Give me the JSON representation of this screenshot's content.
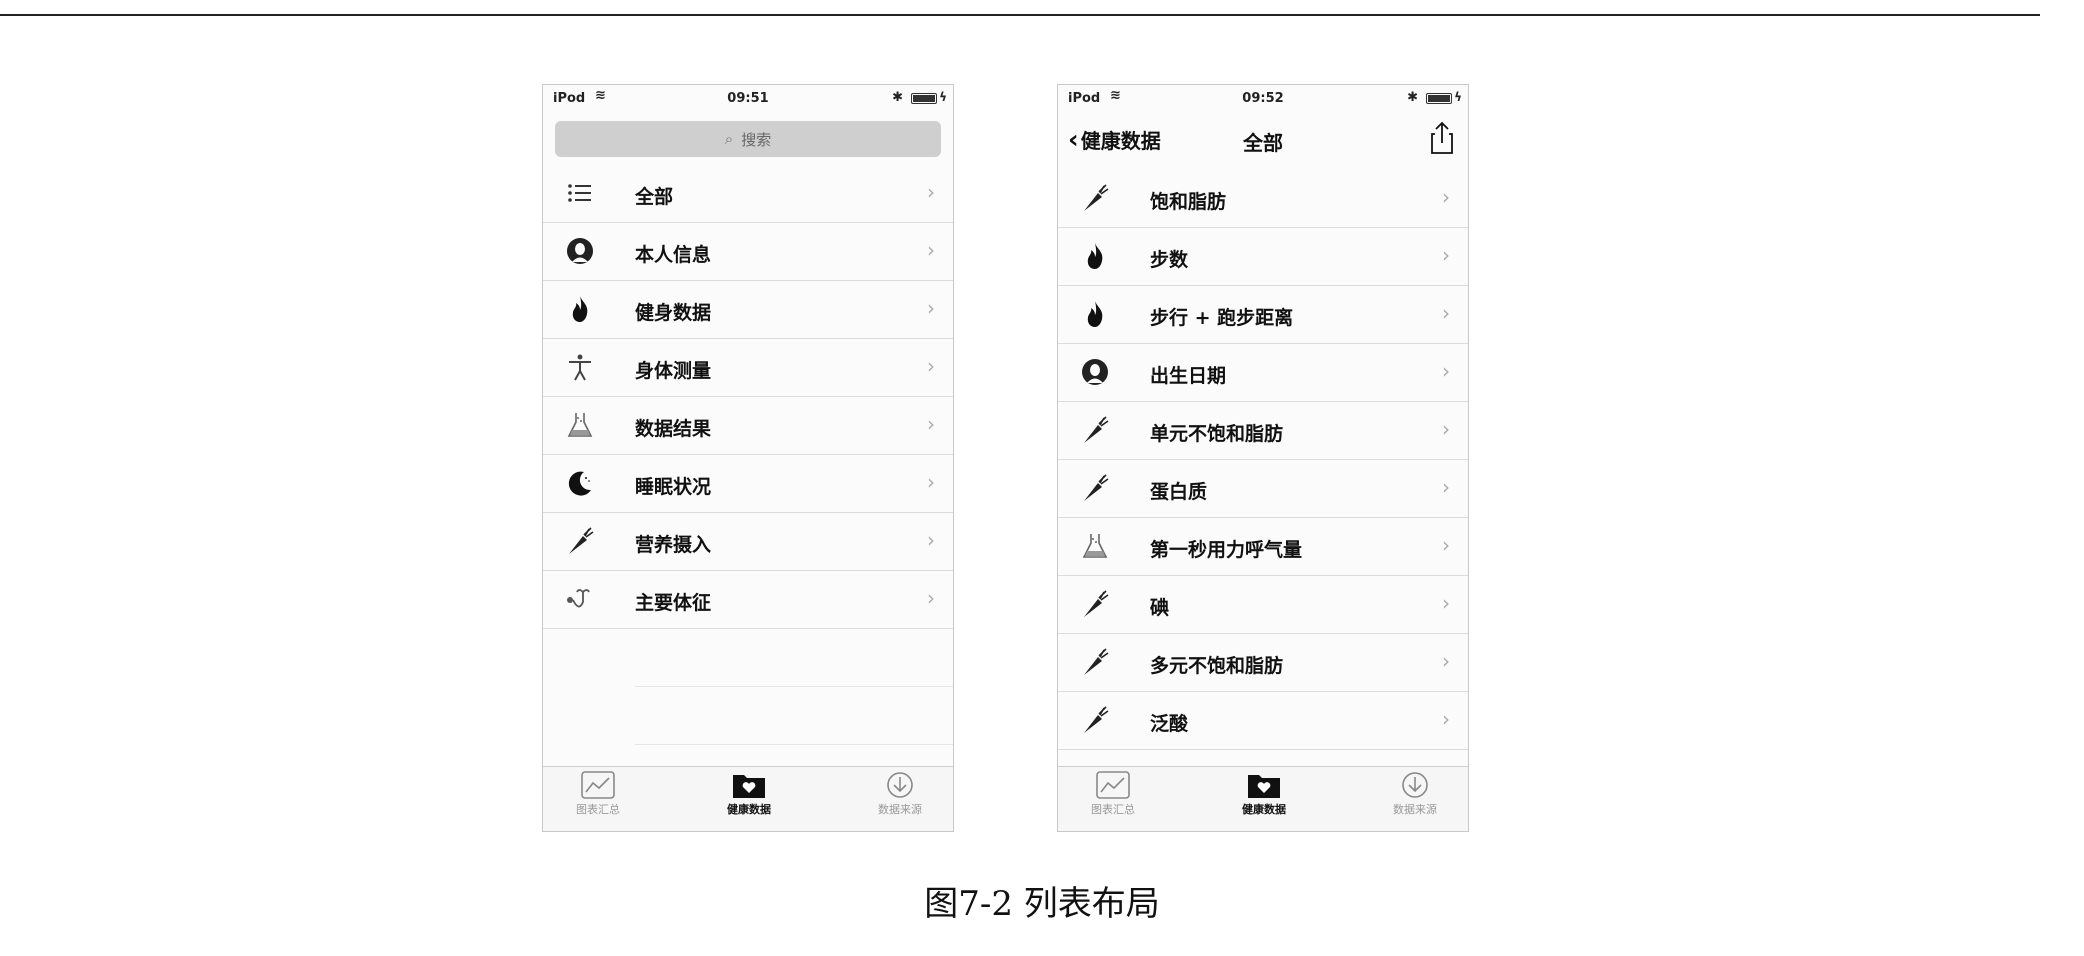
{
  "caption": "图7-2   列表布局",
  "left_screen": {
    "status": {
      "carrier": "iPod",
      "time": "09:51"
    },
    "search_placeholder": "搜索",
    "items": [
      {
        "label": "全部",
        "icon": "list-icon"
      },
      {
        "label": "本人信息",
        "icon": "person-icon"
      },
      {
        "label": "健身数据",
        "icon": "flame-icon"
      },
      {
        "label": "身体测量",
        "icon": "body-icon"
      },
      {
        "label": "数据结果",
        "icon": "flask-icon"
      },
      {
        "label": "睡眠状况",
        "icon": "moon-icon"
      },
      {
        "label": "营养摄入",
        "icon": "carrot-icon"
      },
      {
        "label": "主要体征",
        "icon": "stethoscope-icon"
      }
    ],
    "tabs": [
      {
        "label": "图表汇总",
        "icon": "chart-icon"
      },
      {
        "label": "健康数据",
        "icon": "folder-heart-icon",
        "active": true
      },
      {
        "label": "数据来源",
        "icon": "download-icon"
      }
    ]
  },
  "right_screen": {
    "status": {
      "carrier": "iPod",
      "time": "09:52"
    },
    "nav": {
      "back_label": "健康数据",
      "title": "全部"
    },
    "items": [
      {
        "label": "饱和脂肪",
        "icon": "carrot-icon"
      },
      {
        "label": "步数",
        "icon": "flame-icon"
      },
      {
        "label": "步行 + 跑步距离",
        "icon": "flame-icon"
      },
      {
        "label": "出生日期",
        "icon": "person-icon"
      },
      {
        "label": "单元不饱和脂肪",
        "icon": "carrot-icon"
      },
      {
        "label": "蛋白质",
        "icon": "carrot-icon"
      },
      {
        "label": "第一秒用力呼气量",
        "icon": "flask-icon"
      },
      {
        "label": "碘",
        "icon": "carrot-icon"
      },
      {
        "label": "多元不饱和脂肪",
        "icon": "carrot-icon"
      },
      {
        "label": "泛酸",
        "icon": "carrot-icon"
      }
    ],
    "tabs": [
      {
        "label": "图表汇总",
        "icon": "chart-icon"
      },
      {
        "label": "健康数据",
        "icon": "folder-heart-icon",
        "active": true
      },
      {
        "label": "数据来源",
        "icon": "download-icon"
      }
    ]
  }
}
